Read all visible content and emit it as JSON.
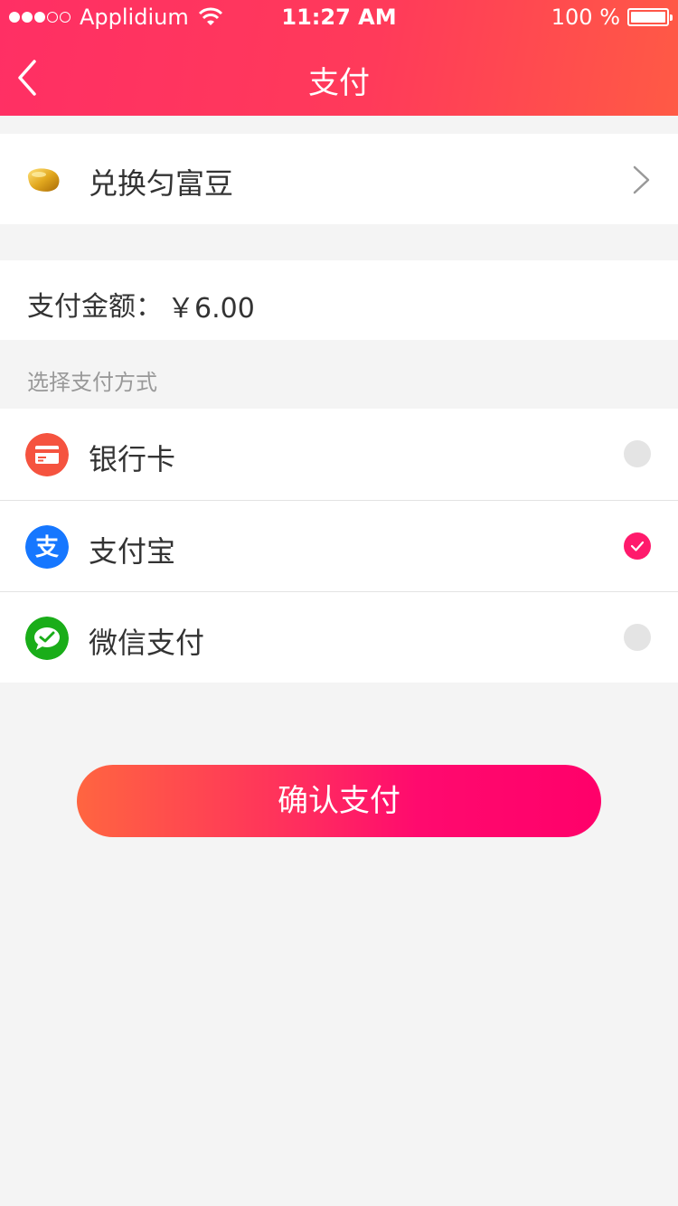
{
  "status_bar": {
    "carrier": "Applidium",
    "time": "11:27 AM",
    "battery": "100 %"
  },
  "header": {
    "title": "支付",
    "back_icon": "chevron-left-icon"
  },
  "exchange": {
    "label": "兑换匀富豆",
    "icon": "bean-icon"
  },
  "amount": {
    "label": "支付金额：",
    "value": "￥6.00"
  },
  "payment": {
    "section_title": "选择支付方式",
    "methods": [
      {
        "label": "银行卡",
        "icon": "bank-card-icon",
        "color": "#f5533f",
        "selected": false
      },
      {
        "label": "支付宝",
        "icon": "alipay-icon",
        "color": "#1677ff",
        "selected": true
      },
      {
        "label": "微信支付",
        "icon": "wechat-pay-icon",
        "color": "#1aad19",
        "selected": false
      }
    ]
  },
  "confirm": {
    "label": "确认支付"
  },
  "colors": {
    "accent": "#ff1a6c",
    "header_start": "#ff2f64",
    "header_end": "#ff5a45"
  }
}
